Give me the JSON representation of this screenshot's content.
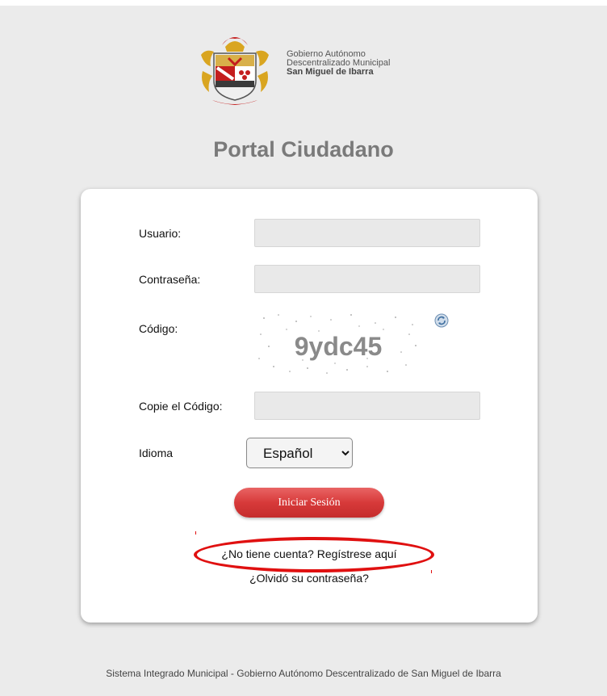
{
  "header": {
    "org_line1": "Gobierno Autónomo",
    "org_line2": "Descentralizado Municipal",
    "org_line3": "San Miguel de Ibarra"
  },
  "title": "Portal Ciudadano",
  "form": {
    "usuario_label": "Usuario:",
    "usuario_value": "",
    "password_label": "Contraseña:",
    "password_value": "",
    "codigo_label": "Código:",
    "captcha_text": "9ydc45",
    "copy_code_label": "Copie el Código:",
    "copy_code_value": "",
    "idioma_label": "Idioma",
    "idioma_selected": "Español",
    "login_button": "Iniciar Sesión"
  },
  "links": {
    "register": "¿No tiene cuenta? Regístrese aquí",
    "forgot_password": "¿Olvidó su contraseña?"
  },
  "annotation": {
    "highlight_color": "#e01010"
  },
  "footer": "Sistema Integrado Municipal - Gobierno Autónomo Descentralizado de San Miguel de Ibarra"
}
